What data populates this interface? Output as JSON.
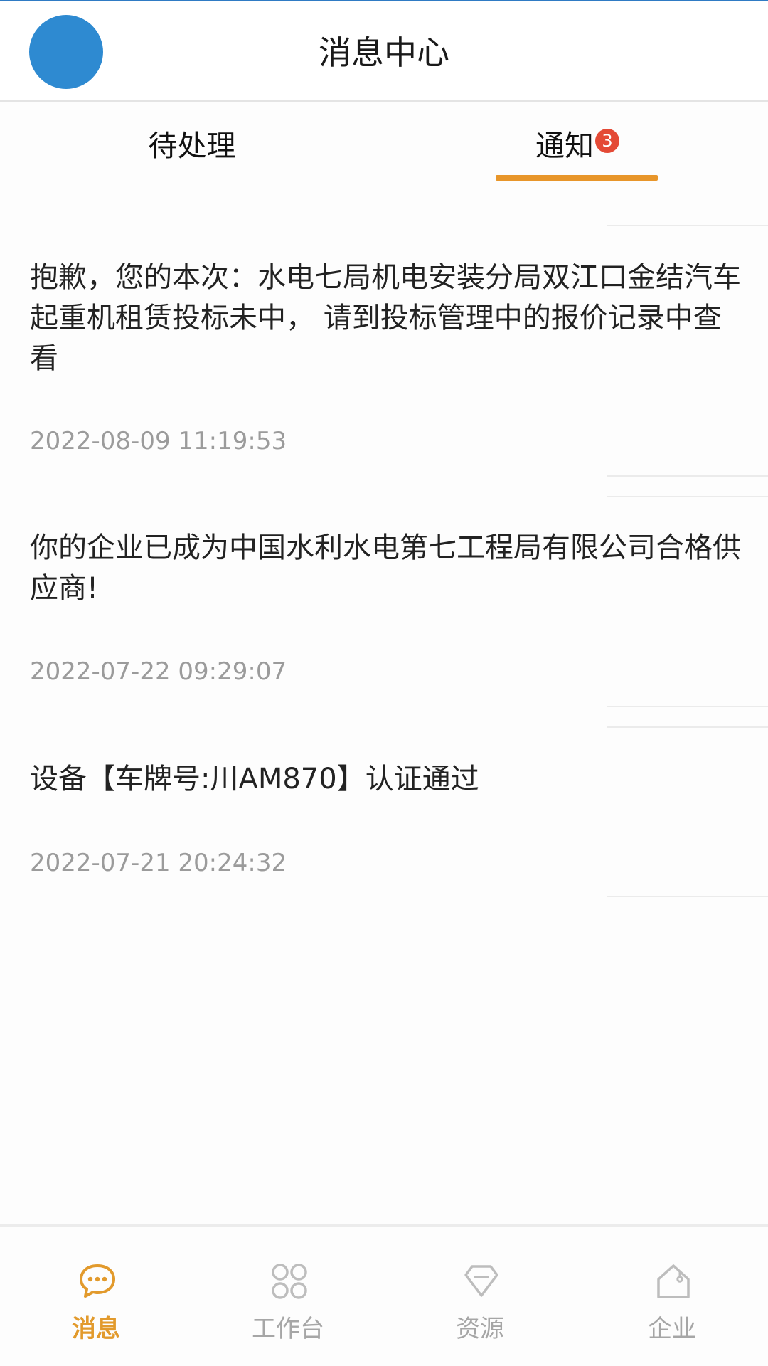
{
  "header": {
    "title": "消息中心"
  },
  "tabs": [
    {
      "label": "待处理"
    },
    {
      "label": "通知",
      "badge": "3",
      "active": true
    }
  ],
  "messages": [
    {
      "text": "抱歉，您的本次：水电七局机电安装分局双江口金结汽车起重机租赁投标未中， 请到投标管理中的报价记录中查看",
      "time": "2022-08-09 11:19:53"
    },
    {
      "text": "你的企业已成为中国水利水电第七工程局有限公司合格供应商!",
      "time": "2022-07-22 09:29:07"
    },
    {
      "text": "设备【车牌号:川AM870】认证通过",
      "time": "2022-07-21 20:24:32"
    }
  ],
  "bottom_nav": [
    {
      "label": "消息",
      "icon": "chat-bubble-icon",
      "active": true
    },
    {
      "label": "工作台",
      "icon": "grid-icon"
    },
    {
      "label": "资源",
      "icon": "gem-icon"
    },
    {
      "label": "企业",
      "icon": "house-icon"
    }
  ],
  "colors": {
    "accent": "#e8962a",
    "badge": "#e44a36",
    "avatar": "#2e8ad1",
    "muted": "#9b9b9b"
  }
}
